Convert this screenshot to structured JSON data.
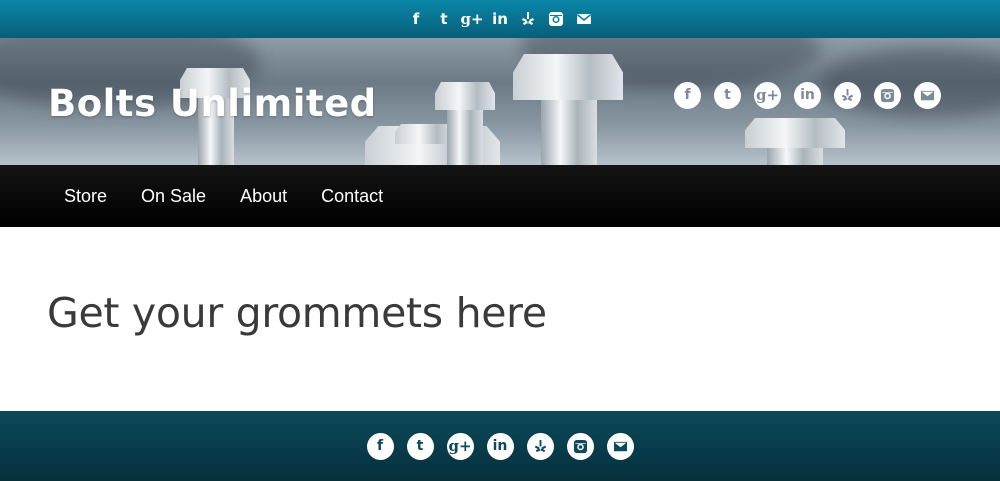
{
  "site": {
    "brand": "Bolts Unlimited"
  },
  "social": {
    "icons": [
      "facebook-icon",
      "twitter-icon",
      "google-plus-icon",
      "linkedin-icon",
      "yelp-icon",
      "instagram-icon",
      "email-icon"
    ],
    "glyphs": {
      "facebook": "f",
      "twitter": "t",
      "google_plus": "g+",
      "linkedin": "in"
    }
  },
  "nav": {
    "items": [
      "Store",
      "On Sale",
      "About",
      "Contact"
    ]
  },
  "main": {
    "heading": "Get your grommets here"
  },
  "colors": {
    "topbar": "#0b87a8",
    "nav": "#000000",
    "footer": "#0b4a5c",
    "heading": "#3a3a3a"
  }
}
